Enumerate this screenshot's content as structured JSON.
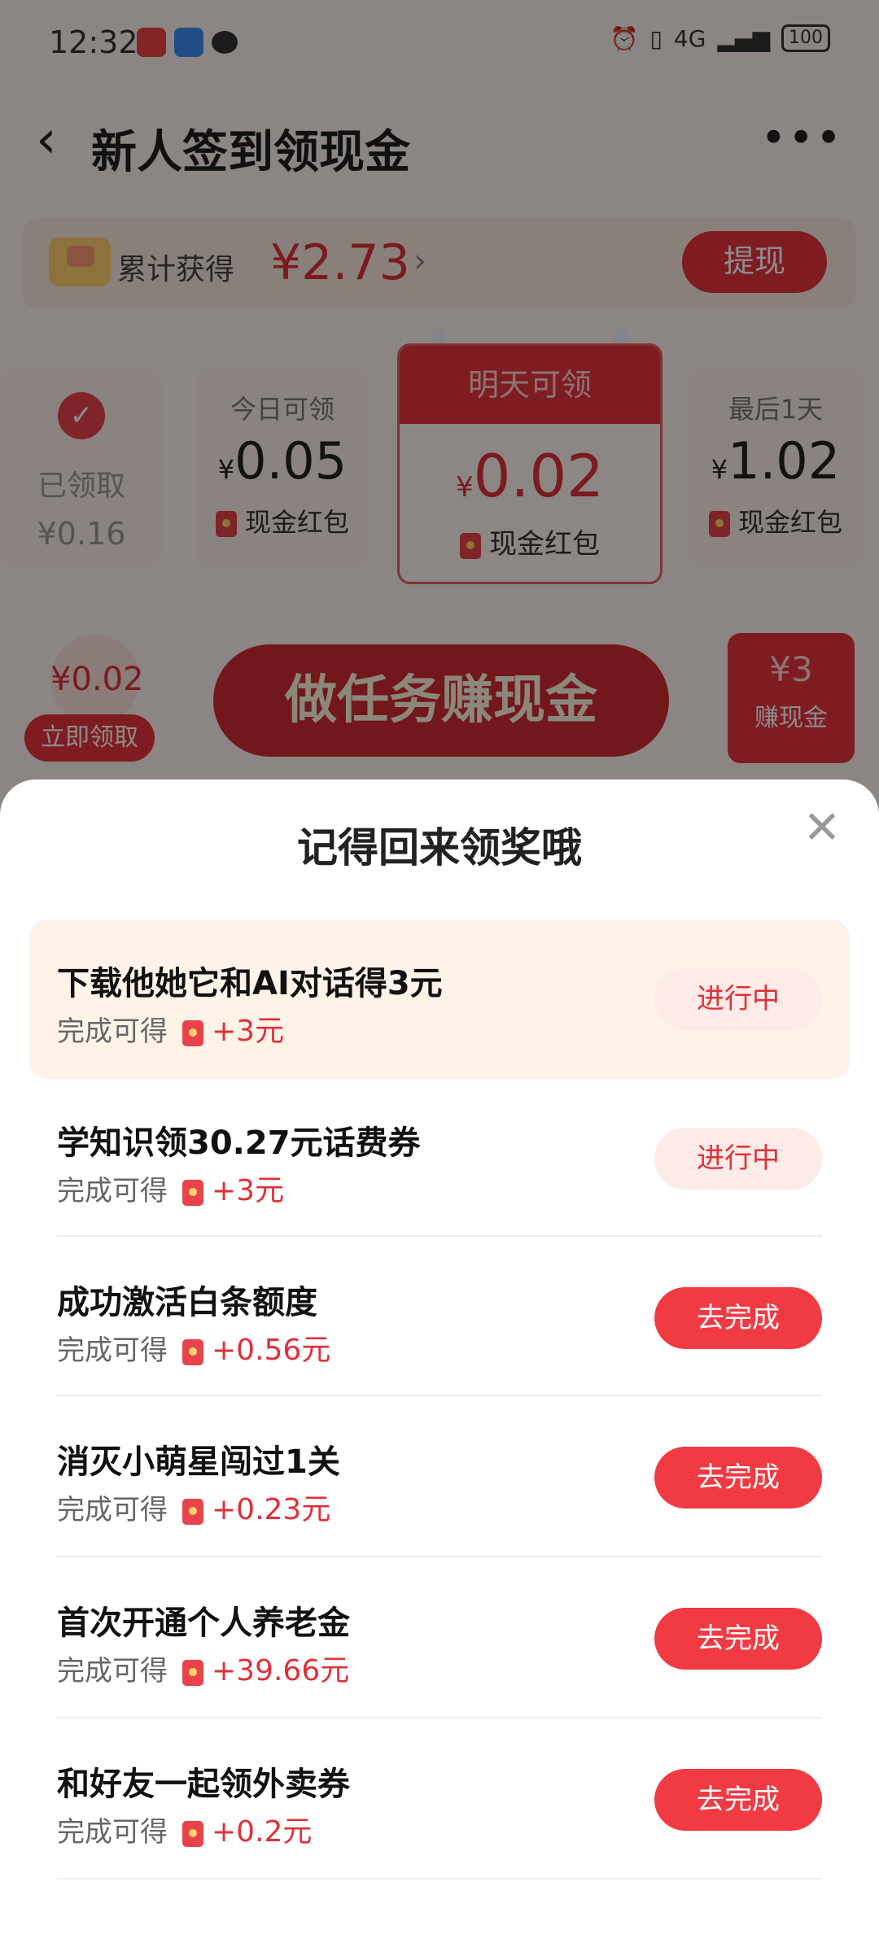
{
  "status_bar": {
    "time": "12:32",
    "battery": "100",
    "signal": "4G"
  },
  "header": {
    "title": "新人签到领现金",
    "back_icon": "chevron-left-icon",
    "more_icon": "more-icon"
  },
  "earned": {
    "label": "累计获得",
    "amount": "¥2.73",
    "withdraw_label": "提现"
  },
  "days": [
    {
      "status": "已领取",
      "value": "¥0.16"
    },
    {
      "label": "今日可领",
      "currency": "¥",
      "value": "0.05",
      "sub": "现金红包"
    },
    {
      "label": "明天可领",
      "currency": "¥",
      "value": "0.02",
      "sub": "现金红包"
    },
    {
      "label": "最后1天",
      "currency": "¥",
      "value": "1.02",
      "sub": "现金红包"
    }
  ],
  "promo": {
    "bubble_value": "¥0.02",
    "claim_label": "立即领取",
    "banner_text": "做任务赚现金",
    "earn_value": "¥3",
    "earn_label": "赚现金"
  },
  "sheet": {
    "title": "记得回来领奖哦",
    "reward_prefix": "完成可得",
    "tasks": [
      {
        "title": "下载他她它和AI对话得3元",
        "reward": "+3元",
        "button": "进行中"
      },
      {
        "title": "学知识领30.27元话费券",
        "reward": "+3元",
        "button": "进行中"
      },
      {
        "title": "成功激活白条额度",
        "reward": "+0.56元",
        "button": "去完成"
      },
      {
        "title": "消灭小萌星闯过1关",
        "reward": "+0.23元",
        "button": "去完成"
      },
      {
        "title": "首次开通个人养老金",
        "reward": "+39.66元",
        "button": "去完成"
      },
      {
        "title": "和好友一起领外卖券",
        "reward": "+0.2元",
        "button": "去完成"
      }
    ]
  }
}
